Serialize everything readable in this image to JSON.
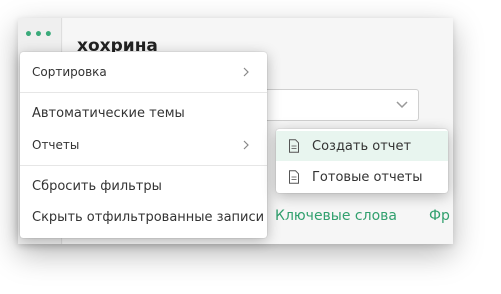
{
  "app": {
    "title": "хохрина",
    "dots": "•••",
    "tabs": {
      "keywords": "Ключевые слова",
      "phrases": "Фр"
    }
  },
  "context_menu": {
    "items": [
      {
        "label": "Сортировка",
        "has_submenu": true
      },
      {
        "label": "Автоматические темы",
        "has_submenu": false
      },
      {
        "label": "Отчеты",
        "has_submenu": true
      },
      {
        "label": "Сбросить фильтры",
        "has_submenu": false
      },
      {
        "label": "Скрыть отфильтрованные записи",
        "has_submenu": false
      }
    ]
  },
  "submenu": {
    "items": [
      {
        "label": "Создать отчет",
        "icon": "document-icon",
        "active": true
      },
      {
        "label": "Готовые отчеты",
        "icon": "document-icon",
        "active": false
      }
    ]
  },
  "colors": {
    "accent": "#31a06e",
    "active_bg": "#e8f5ef"
  }
}
